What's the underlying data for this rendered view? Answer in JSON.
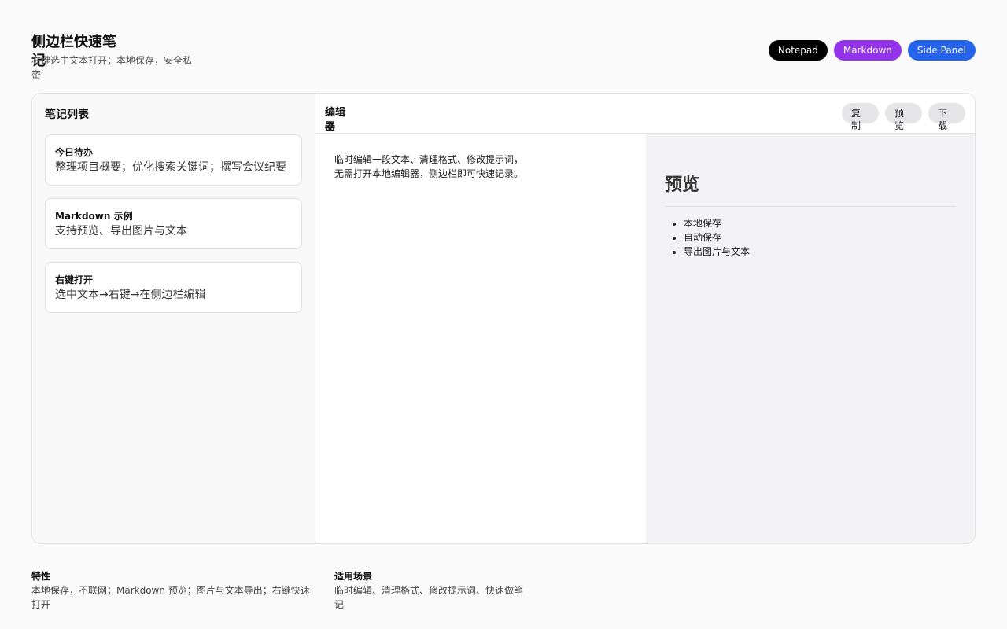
{
  "header": {
    "title": "侧边栏快速笔记",
    "subtitle": "右键选中文本打开；本地保存，安全私密",
    "badges": [
      {
        "label": "Notepad",
        "color": "#000000"
      },
      {
        "label": "Markdown",
        "color": "#9333ea"
      },
      {
        "label": "Side Panel",
        "color": "#2563eb"
      }
    ]
  },
  "sidebar": {
    "title": "笔记列表",
    "notes": [
      {
        "title": "今日待办",
        "preview": "整理项目概要；优化搜索关键词；撰写会议纪要"
      },
      {
        "title": "Markdown 示例",
        "preview": "支持预览、导出图片与文本"
      },
      {
        "title": "右键打开",
        "preview": "选中文本→右键→在侧边栏编辑"
      }
    ]
  },
  "editor": {
    "title": "编辑器",
    "buttons": {
      "copy": "复制",
      "preview": "预览",
      "download": "下载"
    },
    "content": "临时编辑一段文本、清理格式、修改提示词，无需打开本地编辑器，侧边栏即可快速记录。"
  },
  "preview": {
    "heading": "预览",
    "items": [
      "本地保存",
      "自动保存",
      "导出图片与文本"
    ]
  },
  "footer": {
    "features_title": "特性",
    "features_text": "本地保存，不联网；Markdown 预览；图片与文本导出；右键快速打开",
    "scenes_title": "适用场景",
    "scenes_text": "临时编辑、清理格式、修改提示词、快速做笔记"
  }
}
